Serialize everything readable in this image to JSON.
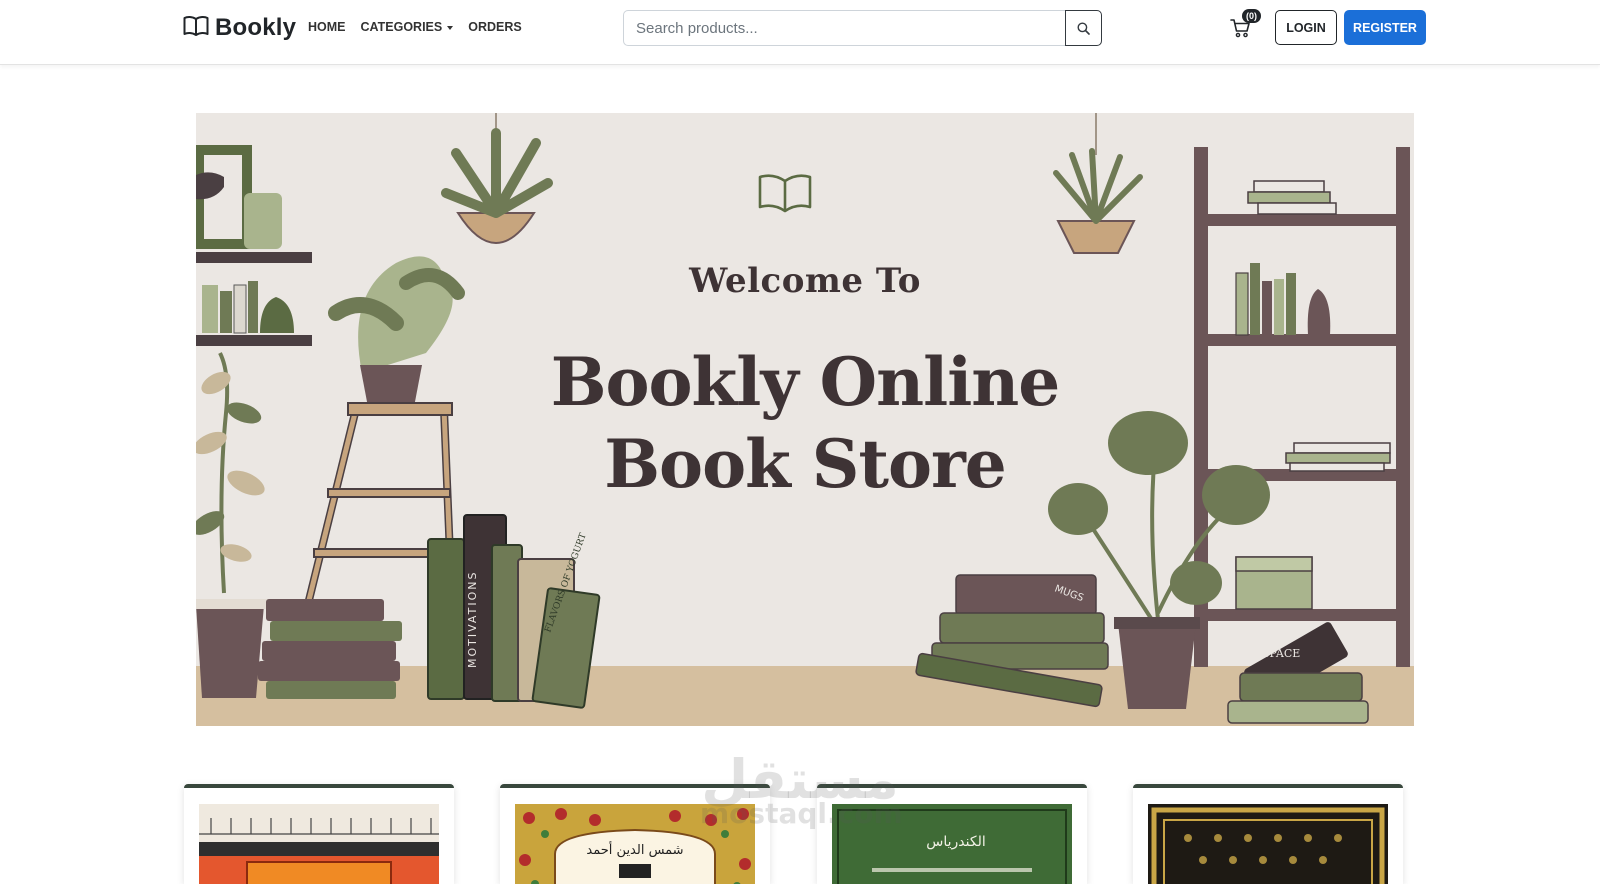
{
  "navbar": {
    "brand": "Bookly",
    "links": [
      {
        "label": "HOME"
      },
      {
        "label": "CATEGORIES"
      },
      {
        "label": "ORDERS"
      }
    ],
    "search": {
      "placeholder": "Search products..."
    },
    "cart_count": "(0)",
    "login_label": "LOGIN",
    "register_label": "REGISTER",
    "accent_color": "#1b6fd8"
  },
  "hero": {
    "welcome": "Welcome To",
    "title_line1": "Bookly Online",
    "title_line2": "Book Store",
    "book_spines": [
      "MOTIVATIONS",
      "FLAVORS OF YOGURT",
      "MUGS",
      "SPACE"
    ]
  },
  "products": [
    {
      "cover_text": ""
    },
    {
      "cover_text": "شمس الدين أحمد"
    },
    {
      "cover_text": "الكندرياس"
    },
    {
      "cover_text": ""
    }
  ],
  "watermark": {
    "arabic": "مستقل",
    "latin": "mostaql.com"
  }
}
